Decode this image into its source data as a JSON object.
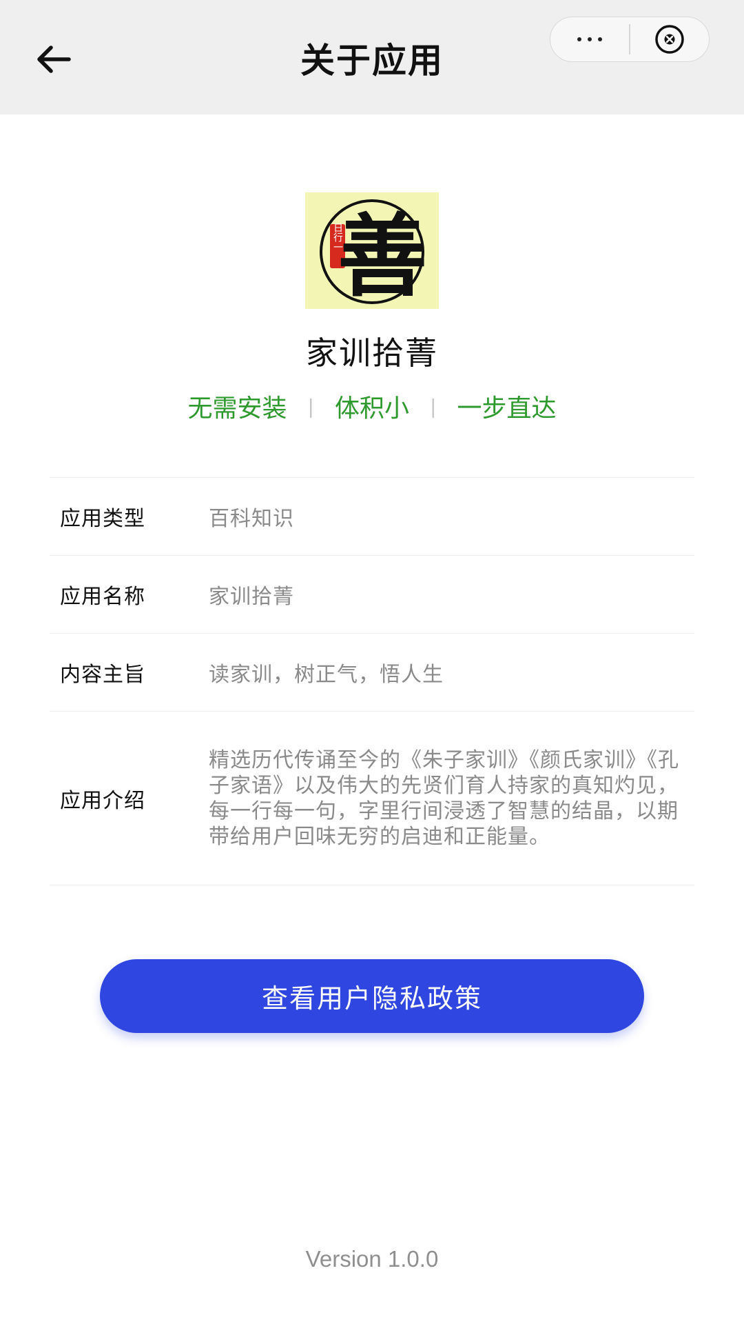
{
  "header": {
    "title": "关于应用",
    "back_icon": "arrow-left-icon",
    "more_icon": "more-dots-icon",
    "close_icon": "close-circle-icon"
  },
  "app": {
    "logo_icon": "shan-calligraphy-logo",
    "logo_vertical_text": "日行一",
    "logo_character": "善",
    "name": "家训拾菁"
  },
  "features": [
    "无需安装",
    "体积小",
    "一步直达"
  ],
  "info": [
    {
      "label": "应用类型",
      "value": "百科知识"
    },
    {
      "label": "应用名称",
      "value": "家训拾菁"
    },
    {
      "label": "内容主旨",
      "value": "读家训，树正气，悟人生"
    },
    {
      "label": "应用介绍",
      "value": "精选历代传诵至今的《朱子家训》《颜氏家训》《孔子家语》以及伟大的先贤们育人持家的真知灼见，每一行每一句，字里行间浸透了智慧的结晶，以期带给用户回味无穷的启迪和正能量。"
    }
  ],
  "privacy_button": "查看用户隐私政策",
  "version": "Version 1.0.0",
  "colors": {
    "header_bg": "#efefef",
    "accent_green": "#2e9a2e",
    "button_blue": "#2f46e0",
    "logo_bg": "#f2f5b4",
    "seal_red": "#d62a1e"
  }
}
